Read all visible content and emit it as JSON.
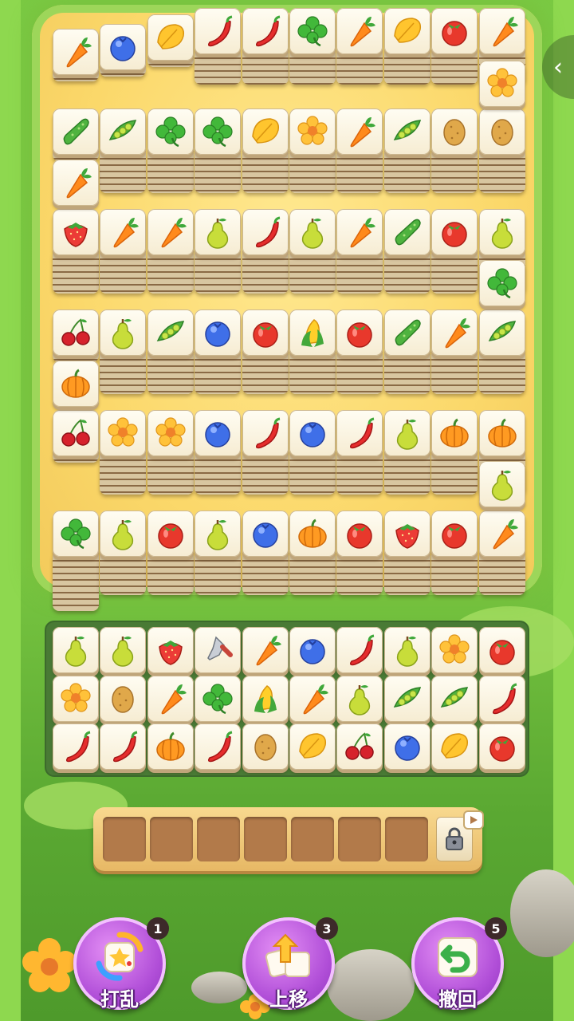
{
  "board": {
    "rows": [
      [
        "carrot",
        "blueberry",
        "leaf",
        "chili",
        "chili",
        "clover",
        "carrot",
        "leaf",
        "tomato",
        "carrot"
      ],
      [
        "cucumber",
        "peapod",
        "clover",
        "clover",
        "leaf",
        "flower",
        "carrot",
        "peapod",
        "potato",
        "potato"
      ],
      [
        "strawberry",
        "carrot",
        "carrot",
        "pear",
        "chili",
        "pear",
        "carrot",
        "cucumber",
        "tomato",
        "pear"
      ],
      [
        "cherry",
        "pear",
        "peapod",
        "blueberry",
        "tomato",
        "corn",
        "tomato",
        "cucumber",
        "carrot",
        "peapod"
      ],
      [
        "cherry",
        "flower",
        "flower",
        "blueberry",
        "chili",
        "blueberry",
        "chili",
        "pear",
        "pumpkin",
        "pumpkin"
      ],
      [
        "clover",
        "pear",
        "tomato",
        "pear",
        "blueberry",
        "pumpkin",
        "tomato",
        "strawberry",
        "tomato",
        "carrot"
      ]
    ],
    "connectors": [
      {
        "after_row": 0,
        "side": "right",
        "item": "flower"
      },
      {
        "after_row": 1,
        "side": "left",
        "item": "carrot"
      },
      {
        "after_row": 2,
        "side": "right",
        "item": "clover"
      },
      {
        "after_row": 3,
        "side": "left",
        "item": "pumpkin"
      },
      {
        "after_row": 4,
        "side": "right",
        "item": "pear"
      }
    ]
  },
  "tray": {
    "rows": [
      [
        "pear",
        "pear",
        "strawberry",
        "trowel",
        "carrot",
        "blueberry",
        "chili",
        "pear",
        "flower",
        "tomato"
      ],
      [
        "flower",
        "potato",
        "carrot",
        "clover",
        "corn",
        "carrot",
        "pear",
        "peapod",
        "peapod",
        "chili"
      ],
      [
        "chili",
        "chili",
        "pumpkin",
        "chili",
        "potato",
        "leaf",
        "cherry",
        "blueberry",
        "leaf",
        "tomato"
      ]
    ]
  },
  "slots": {
    "empty_count": 7,
    "locked_icon": "lock-icon",
    "ad_icon": "video-play-icon"
  },
  "powerups": [
    {
      "id": "shuffle",
      "label": "打乱",
      "count": "1",
      "icon": "dice-shuffle-icon"
    },
    {
      "id": "move-up",
      "label": "上移",
      "count": "3",
      "icon": "move-up-cards-icon"
    },
    {
      "id": "undo",
      "label": "撤回",
      "count": "5",
      "icon": "undo-arrow-icon"
    }
  ],
  "collapse_icon": "chevron-left-icon",
  "colors": {
    "grass": "#7ac943",
    "path": "#fbd86a",
    "tile": "#fffdf3",
    "powerup": "#b14fd8"
  }
}
